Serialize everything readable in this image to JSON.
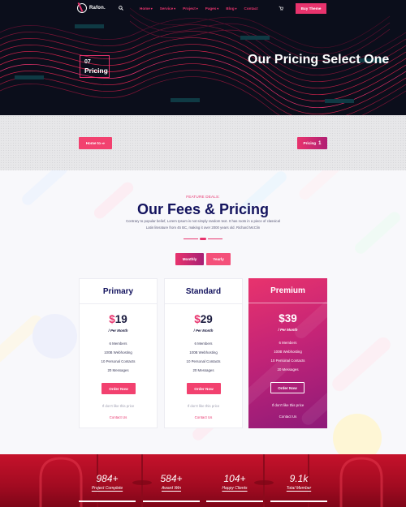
{
  "nav": {
    "logo_text": "Rafon.",
    "menu": [
      "Home",
      "Service",
      "Project",
      "Pages",
      "Blog",
      "Contact"
    ],
    "buy_button": "Buy Theme"
  },
  "hero": {
    "badge_number": "07",
    "badge_label": "Pricing",
    "title": "Our Pricing Select One"
  },
  "breadcrumb": {
    "home": "Home to ⇨",
    "current": "Pricing",
    "current_num": "1"
  },
  "pricing": {
    "eyebrow": "FEATURE DEALS:",
    "title": "Our Fees & Pricing",
    "subtitle": "Contrary to popular belief, Lorem Ipsum is not simply random text. It has roots in a piece of classical Latin literature from 45 BC, making it over 2000 years old. Richard McClin",
    "toggle": {
      "monthly": "Monthly",
      "yearly": "Yearly"
    },
    "plans": [
      {
        "name": "Primary",
        "currency": "$",
        "price": "19",
        "period": "/ Per Month",
        "features": [
          "6 Members",
          "100B Webhosting",
          "10 Personal Contacts",
          "20 Messages"
        ],
        "order": "Order Now",
        "nolike": "If don't like this price",
        "contact": "Contact Us"
      },
      {
        "name": "Standard",
        "currency": "$",
        "price": "29",
        "period": "/ Per Month",
        "features": [
          "6 Members",
          "100B Webhosting",
          "10 Personal Contacts",
          "20 Messages"
        ],
        "order": "Order Now",
        "nolike": "If don't like this price",
        "contact": "Contact Us"
      },
      {
        "name": "Premium",
        "currency": "$",
        "price": "39",
        "period": "/ Per Month",
        "features": [
          "6 Members",
          "100B Webhosting",
          "10 Personal Contacts",
          "20 Messages"
        ],
        "order": "Order Now",
        "nolike": "If don't like this price",
        "contact": "Contact Us"
      }
    ]
  },
  "stats": [
    {
      "value": "984+",
      "caption": "Project Complete"
    },
    {
      "value": "584+",
      "caption": "Award Win"
    },
    {
      "value": "104+",
      "caption": "Happy Clients"
    },
    {
      "value": "9.1k",
      "caption": "Total Member"
    }
  ],
  "colors": {
    "accent": "#e8336d",
    "navy": "#13135e",
    "purple": "#8e1a79",
    "hero_bg": "#0b0e1b",
    "stats_red": "#c5122b"
  },
  "icons": [
    "search-icon",
    "cart-icon",
    "chevron-down-icon"
  ]
}
